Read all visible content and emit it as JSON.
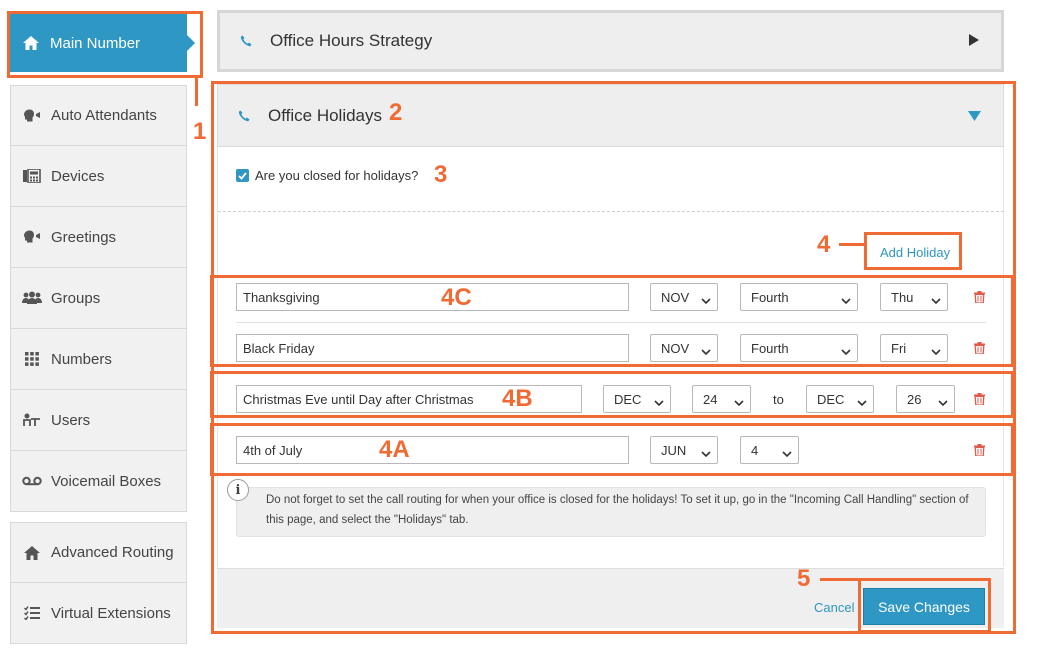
{
  "sidebar": {
    "active": "Main Number",
    "items": [
      {
        "label": "Auto Attendants",
        "icon": "speaker-head-icon"
      },
      {
        "label": "Devices",
        "icon": "fax-machine-icon"
      },
      {
        "label": "Greetings",
        "icon": "speaker-head-icon"
      },
      {
        "label": "Groups",
        "icon": "users-icon"
      },
      {
        "label": "Numbers",
        "icon": "grid-icon"
      },
      {
        "label": "Users",
        "icon": "user-desk-icon"
      },
      {
        "label": "Voicemail Boxes",
        "icon": "voicemail-icon"
      }
    ],
    "extra_items": [
      {
        "label": "Advanced Routing",
        "icon": "home-icon"
      },
      {
        "label": "Virtual Extensions",
        "icon": "list-icon"
      }
    ]
  },
  "panels": {
    "office_hours": {
      "title": "Office Hours Strategy"
    },
    "office_holidays": {
      "title": "Office Holidays"
    }
  },
  "holidays": {
    "closed_question": "Are you closed for holidays?",
    "closed_checked": true,
    "add_label": "Add Holiday",
    "floating": [
      {
        "name": "Thanksgiving",
        "month": "NOV",
        "week": "Fourth",
        "day": "Thu"
      },
      {
        "name": "Black Friday",
        "month": "NOV",
        "week": "Fourth",
        "day": "Fri"
      }
    ],
    "range": {
      "name": "Christmas Eve until Day after Christmas",
      "from_month": "DEC",
      "from_day": "24",
      "to_label": "to",
      "to_month": "DEC",
      "to_day": "26"
    },
    "fixed": {
      "name": "4th of July",
      "month": "JUN",
      "day": "4"
    },
    "info": "Do not forget to set the call routing for when your office is closed for the holidays! To set it up, go in the \"Incoming Call Handling\" section of this page, and select the \"Holidays\" tab."
  },
  "actions": {
    "cancel": "Cancel",
    "save": "Save Changes"
  },
  "annotations": {
    "n1": "1",
    "n2": "2",
    "n3": "3",
    "n4": "4",
    "n4a": "4A",
    "n4b": "4B",
    "n4c": "4C",
    "n5": "5"
  },
  "colors": {
    "accent": "#2e97c3",
    "annotation": "#f06a33",
    "delete": "#e05a4a"
  }
}
